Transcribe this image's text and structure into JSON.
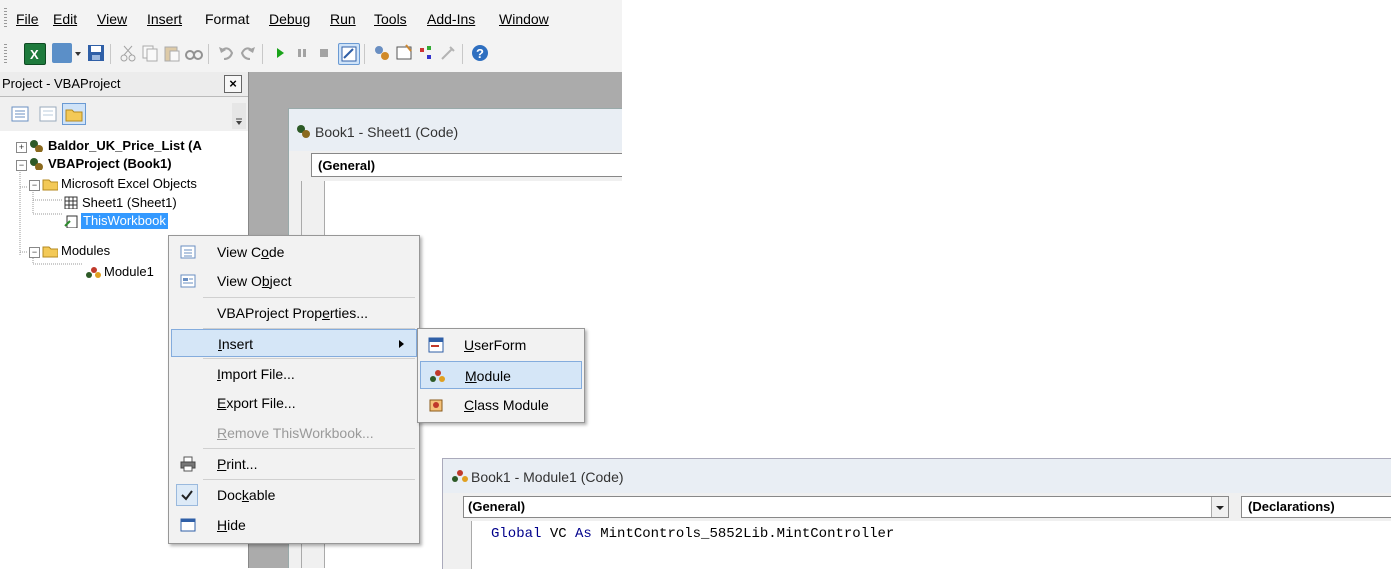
{
  "menubar": {
    "items": [
      "File",
      "Edit",
      "View",
      "Insert",
      "Format",
      "Debug",
      "Run",
      "Tools",
      "Add-Ins",
      "Window"
    ],
    "mnemonic_index": [
      0,
      0,
      0,
      0,
      1,
      0,
      0,
      0,
      0,
      0
    ]
  },
  "project_pane": {
    "title": "Project - VBAProject",
    "close_glyph": "×",
    "tree": {
      "baldor": "Baldor_UK_Price_List (A",
      "vbaproject": "VBAProject (Book1)",
      "excel_objects": "Microsoft Excel Objects",
      "sheet1": "Sheet1 (Sheet1)",
      "thisworkbook": "ThisWorkbook",
      "modules": "Modules",
      "module1": "Module1"
    }
  },
  "code_window_sheet1": {
    "title": "Book1 - Sheet1 (Code)",
    "object_combo": "(General)"
  },
  "context_menu": {
    "items": {
      "view_code": {
        "pre": "View C",
        "u": "o",
        "post": "de"
      },
      "view_object": {
        "pre": "View O",
        "u": "b",
        "post": "ject"
      },
      "properties": {
        "pre": "VBAProject Prop",
        "u": "e",
        "post": "rties..."
      },
      "insert": {
        "pre": "",
        "u": "I",
        "post": "nsert"
      },
      "import": {
        "pre": "",
        "u": "I",
        "post": "mport File..."
      },
      "export": {
        "pre": "",
        "u": "E",
        "post": "xport File..."
      },
      "remove": {
        "pre": "",
        "u": "R",
        "post": "emove ThisWorkbook..."
      },
      "print": {
        "pre": "",
        "u": "P",
        "post": "rint..."
      },
      "dockable": {
        "pre": "Doc",
        "u": "k",
        "post": "able"
      },
      "hide": {
        "pre": "",
        "u": "H",
        "post": "ide"
      }
    }
  },
  "insert_submenu": {
    "userform": {
      "pre": "",
      "u": "U",
      "post": "serForm"
    },
    "module": {
      "pre": "",
      "u": "M",
      "post": "odule"
    },
    "class_module": {
      "pre": "",
      "u": "C",
      "post": "lass Module"
    }
  },
  "code_window_module1": {
    "title": "Book1 - Module1 (Code)",
    "object_combo": "(General)",
    "procedure_combo": "(Declarations)",
    "code_keyword1": "Global",
    "code_mid": " VC ",
    "code_keyword2": "As",
    "code_rest": " MintControls_5852Lib.MintController"
  },
  "colors": {
    "highlight": "#d5e6f7",
    "selection": "#3399ff",
    "code_keyword": "#00008b"
  }
}
